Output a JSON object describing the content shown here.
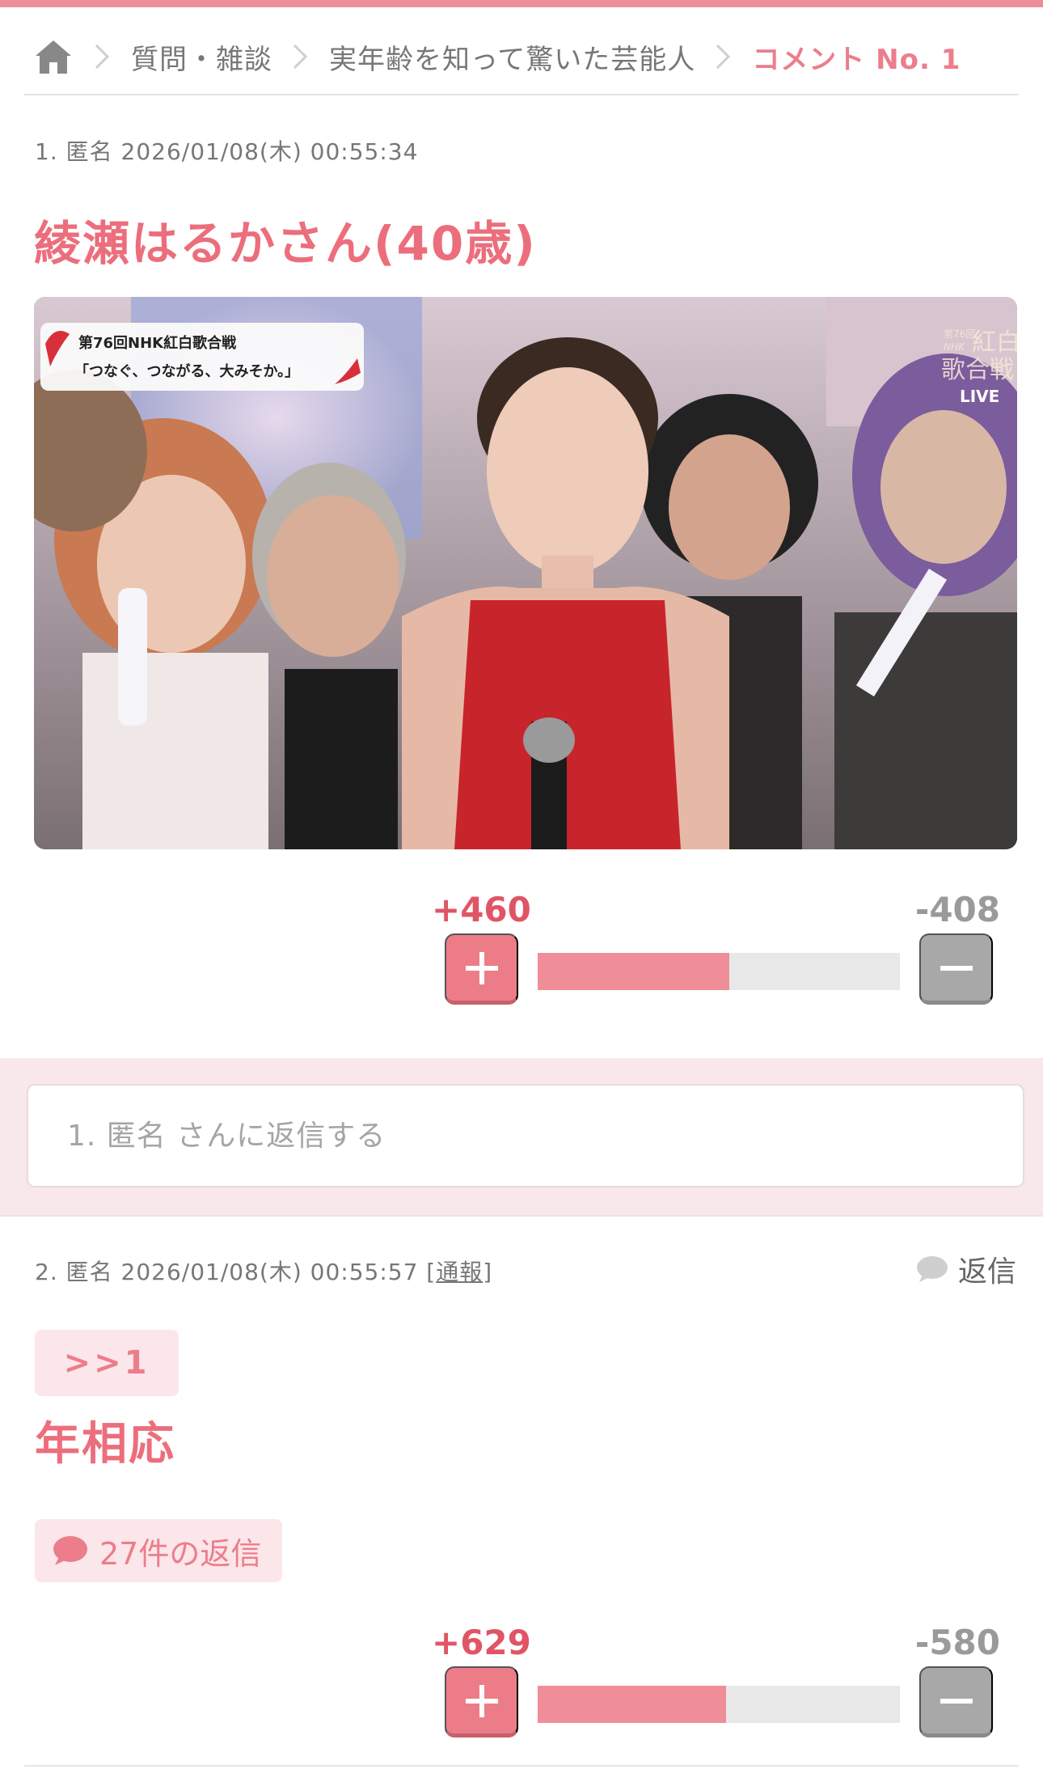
{
  "breadcrumb": {
    "home_icon": "home-icon",
    "items": [
      "質問・雑談",
      "実年齢を知って驚いた芸能人"
    ],
    "current": "コメント No. 1"
  },
  "comment1": {
    "meta": "1. 匿名 2026/01/08(木) 00:55:34",
    "title": "綾瀬はるかさん(40歳)",
    "image": {
      "overlay_title": "第76回NHK紅白歌合戦",
      "overlay_subtitle": "「つなぐ、つながる、大みそか。」",
      "watermark_lines": [
        "第76回",
        "NHK",
        "紅白",
        "歌合戦"
      ],
      "watermark_live": "LIVE"
    },
    "votes": {
      "plus": "+460",
      "minus": "-408",
      "plus_ratio": 0.53
    }
  },
  "reply_box": {
    "placeholder": "1. 匿名 さんに返信する"
  },
  "comment2": {
    "meta_prefix": "2. 匿名 2026/01/08(木) 00:55:57 [",
    "report_label": "通報",
    "meta_suffix": "]",
    "reply_label": "返信",
    "anchor": ">>1",
    "body": "年相応",
    "replies_label": "27件の返信",
    "votes": {
      "plus": "+629",
      "minus": "-580",
      "plus_ratio": 0.52
    }
  },
  "colors": {
    "accent": "#ec6e7c",
    "bar_fill": "#ef8e98",
    "bar_track": "#e8e8e8",
    "band": "#f8e8ec",
    "minus_button": "#a8a8a8"
  }
}
